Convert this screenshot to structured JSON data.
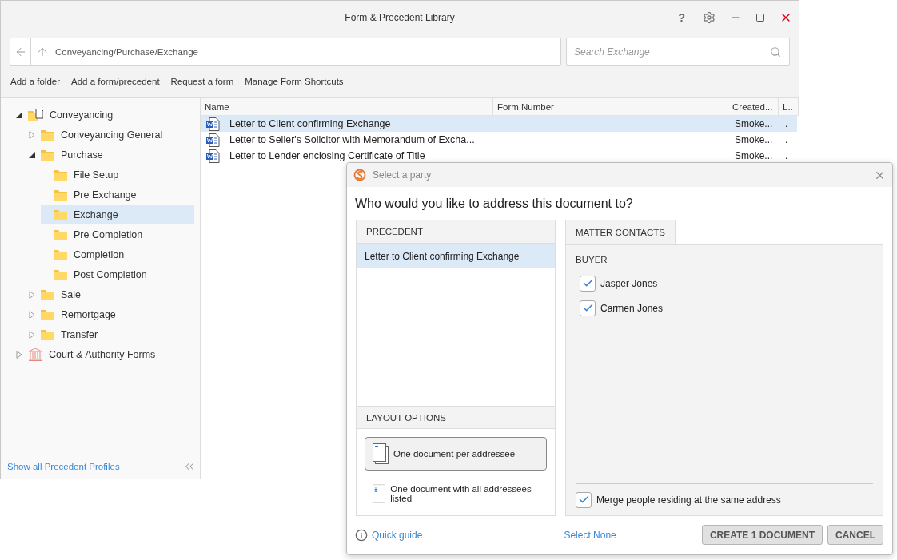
{
  "window": {
    "title": "Form & Precedent Library",
    "controls": [
      "?"
    ]
  },
  "address": {
    "path": "Conveyancing/Purchase/Exchange"
  },
  "search": {
    "placeholder": "Search Exchange"
  },
  "toolbar": [
    "Add a folder",
    "Add a form/precedent",
    "Request a form",
    "Manage Form Shortcuts"
  ],
  "tree": [
    {
      "label": "Conveyancing",
      "kind": "book",
      "expanded": true,
      "selected": false,
      "children": [
        {
          "label": "Conveyancing General",
          "kind": "folder",
          "expanded": false,
          "selected": false
        },
        {
          "label": "Purchase",
          "kind": "folder",
          "expanded": true,
          "selected": false,
          "children": [
            {
              "label": "File Setup",
              "kind": "folder",
              "selected": false
            },
            {
              "label": "Pre Exchange",
              "kind": "folder",
              "selected": false
            },
            {
              "label": "Exchange",
              "kind": "folder",
              "selected": true
            },
            {
              "label": "Pre Completion",
              "kind": "folder",
              "selected": false
            },
            {
              "label": "Completion",
              "kind": "folder",
              "selected": false
            },
            {
              "label": "Post Completion",
              "kind": "folder",
              "selected": false
            }
          ]
        },
        {
          "label": "Sale",
          "kind": "folder",
          "expanded": false,
          "selected": false
        },
        {
          "label": "Remortgage",
          "kind": "folder",
          "expanded": false,
          "selected": false
        },
        {
          "label": "Transfer",
          "kind": "folder",
          "expanded": false,
          "selected": false
        }
      ]
    },
    {
      "label": "Court & Authority Forms",
      "kind": "court",
      "expanded": false,
      "selected": false
    }
  ],
  "profiles_link": "Show all Precedent Profiles",
  "table": {
    "columns": [
      "Name",
      "Form Number",
      "Created...",
      "L.."
    ],
    "rows": [
      {
        "name": "Letter to Client confirming Exchange",
        "created": "Smoke...",
        "column_4": ".",
        "selected": true
      },
      {
        "name": "Letter to Seller's Solicitor with Memorandum of Excha...",
        "created": "Smoke...",
        "column_4": ".",
        "selected": false
      },
      {
        "name": "Letter to Lender enclosing Certificate of Title",
        "created": "Smoke...",
        "column_4": ".",
        "selected": false
      }
    ]
  },
  "dialog": {
    "title": "Select a party",
    "question": "Who would you like to address this document to?",
    "precedent_header": "PRECEDENT",
    "precedents": [
      {
        "label": "Letter to Client confirming Exchange",
        "selected": true
      }
    ],
    "layout_header": "LAYOUT OPTIONS",
    "layout_options": [
      {
        "label": "One document per addressee",
        "kind": "stack",
        "selected": true
      },
      {
        "label": "One document with all addressees listed",
        "kind": "list",
        "selected": false
      }
    ],
    "tab": {
      "label": "MATTER CONTACTS",
      "selected": true
    },
    "group": "BUYER",
    "contacts": [
      {
        "name": "Jasper Jones",
        "checked": true
      },
      {
        "name": "Carmen Jones",
        "checked": true
      }
    ],
    "merge": {
      "label": "Merge people residing at the same address",
      "checked": true
    },
    "quick_guide": "Quick guide",
    "select_none": "Select None",
    "buttons": [
      "CREATE 1 DOCUMENT",
      "CANCEL"
    ]
  }
}
